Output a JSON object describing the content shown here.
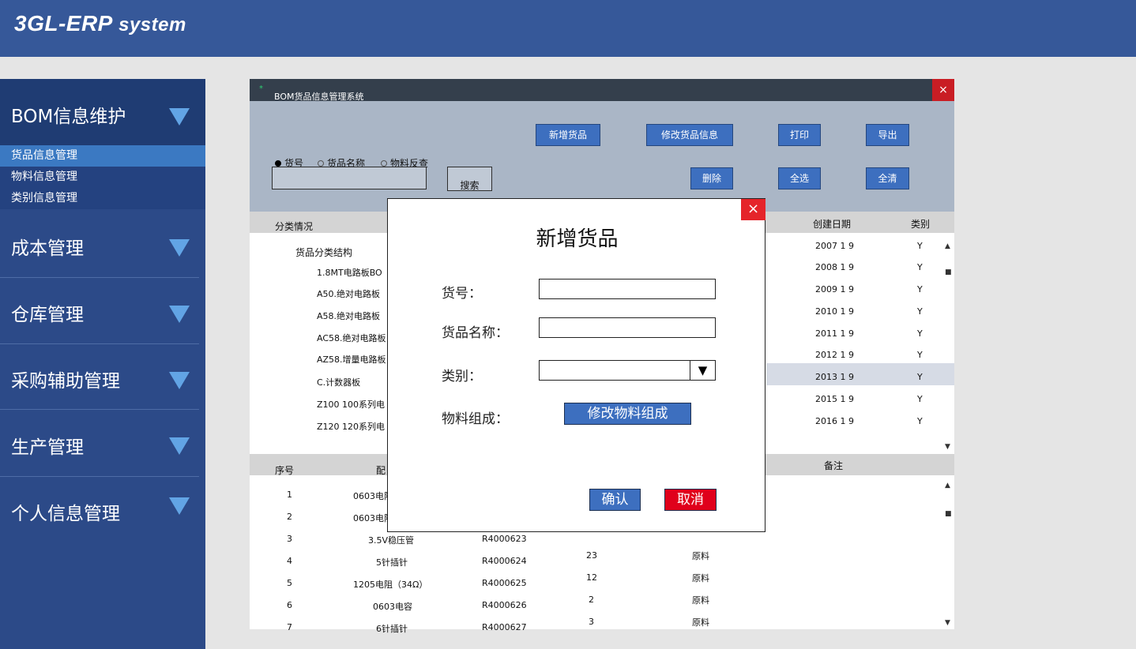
{
  "app": {
    "title_main": "3GL-ERP",
    "title_sub": "system"
  },
  "sidebar": {
    "groups": [
      {
        "label": "BOM信息维护"
      },
      {
        "label": "成本管理"
      },
      {
        "label": "仓库管理"
      },
      {
        "label": "采购辅助管理"
      },
      {
        "label": "生产管理"
      },
      {
        "label": "个人信息管理"
      }
    ],
    "bom_items": [
      "货品信息管理",
      "物料信息管理",
      "类别信息管理"
    ]
  },
  "window": {
    "title": "BOM货品信息管理系统",
    "close": "×",
    "radios": [
      {
        "label": "货号",
        "selected": true
      },
      {
        "label": "货品名称",
        "selected": false
      },
      {
        "label": "物料反查",
        "selected": false
      }
    ],
    "buttons": {
      "add": "新增货品",
      "edit": "修改货品信息",
      "print": "打印",
      "export": "导出",
      "delete": "删除",
      "select_all": "全选",
      "clear_all": "全清",
      "search": "搜索"
    },
    "search_value": ""
  },
  "upper_table": {
    "headers": {
      "category": "分类情况",
      "created": "创建日期",
      "type": "类别"
    },
    "tree_root": "货品分类结构",
    "tree_items": [
      "1.8MT电路板BO",
      "A50.绝对电路板",
      "A58.绝对电路板",
      "AC58.绝对电路板",
      "AZ58.增量电路板",
      "C.计数器板",
      "Z100 100系列电",
      "Z120 120系列电"
    ],
    "dates": [
      "2007 1 9",
      "2008 1 9",
      "2009 1 9",
      "2010 1 9",
      "2011 1 9",
      "2012 1 9",
      "2013 1 9",
      "2015 1 9",
      "2016 1 9"
    ],
    "types": [
      "Y",
      "Y",
      "Y",
      "Y",
      "Y",
      "Y",
      "Y",
      "Y",
      "Y"
    ]
  },
  "lower_table": {
    "headers": {
      "seq": "序号",
      "part": "配",
      "note": "备注"
    },
    "rows": [
      {
        "seq": "1",
        "name": "0603电阻",
        "code": "",
        "qty": "",
        "kind": ""
      },
      {
        "seq": "2",
        "name": "0603电阻",
        "code": "",
        "qty": "",
        "kind": ""
      },
      {
        "seq": "3",
        "name": "3.5V稳压管",
        "code": "R4000623",
        "qty": "",
        "kind": ""
      },
      {
        "seq": "4",
        "name": "5针插针",
        "code": "R4000624",
        "qty": "23",
        "kind": "原料"
      },
      {
        "seq": "5",
        "name": "1205电阻（34Ω）",
        "code": "R4000625",
        "qty": "12",
        "kind": "原料"
      },
      {
        "seq": "6",
        "name": "0603电容",
        "code": "R4000626",
        "qty": "2",
        "kind": "原料"
      },
      {
        "seq": "7",
        "name": "6针插针",
        "code": "R4000627",
        "qty": "3",
        "kind": "原料"
      }
    ]
  },
  "modal": {
    "title": "新增货品",
    "close": "×",
    "labels": {
      "code": "货号：",
      "name": "货品名称：",
      "type": "类别：",
      "materials": "物料组成："
    },
    "values": {
      "code": "",
      "name": "",
      "type": ""
    },
    "select_arrow": "▼",
    "buttons": {
      "modify": "修改物料组成",
      "confirm": "确认",
      "cancel": "取消"
    }
  },
  "colors": {
    "header": "#365899",
    "sidebar": "#2c4a88",
    "accent": "#3d6fbf",
    "danger": "#e0001b"
  }
}
